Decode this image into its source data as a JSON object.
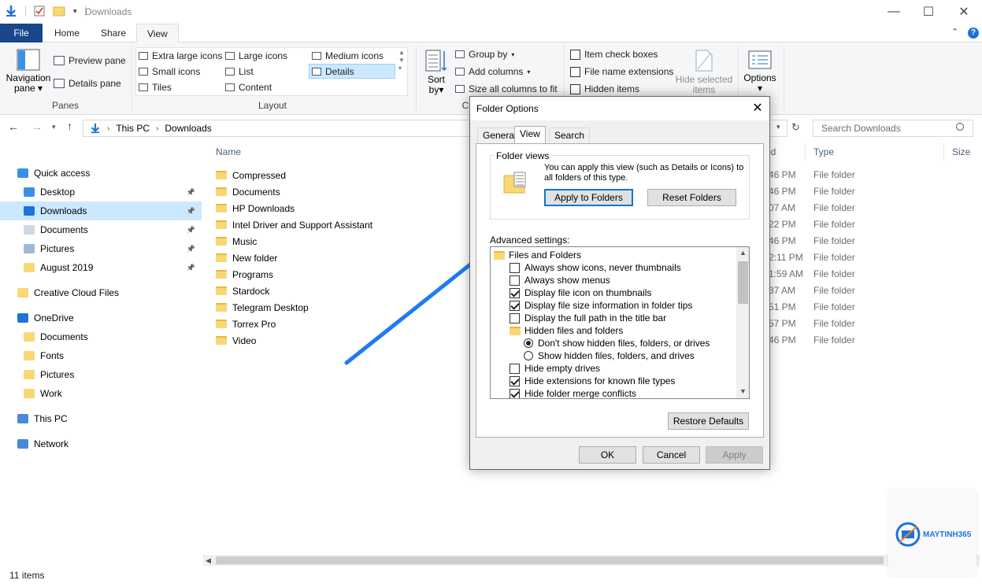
{
  "window": {
    "title": "Downloads"
  },
  "ribbon_tabs": [
    {
      "label": "File"
    },
    {
      "label": "Home"
    },
    {
      "label": "Share"
    },
    {
      "label": "View"
    }
  ],
  "ribbon": {
    "panes": {
      "navigation_pane": "Navigation",
      "navigation_pane2": "pane",
      "preview_pane": "Preview pane",
      "details_pane": "Details pane",
      "group_label": "Panes"
    },
    "layout": {
      "items": [
        "Extra large icons",
        "Large icons",
        "Medium icons",
        "Small icons",
        "List",
        "Details",
        "Tiles",
        "Content"
      ],
      "group_label": "Layout"
    },
    "current_view": {
      "sort_by": "Sort",
      "sort_by2": "by",
      "group_by": "Group by",
      "add_columns": "Add columns",
      "size_columns": "Size all columns to fit",
      "group_label": "C"
    },
    "show_hide": {
      "item_check_boxes": "Item check boxes",
      "file_name_extensions": "File name extensions",
      "hidden_items": "Hidden items",
      "hide_selected": "Hide selected",
      "hide_selected2": "items"
    },
    "options": "Options"
  },
  "address": {
    "crumbs": [
      "This PC",
      "Downloads"
    ],
    "search_placeholder": "Search Downloads"
  },
  "nav": {
    "items": [
      {
        "label": "Quick access"
      },
      {
        "label": "Desktop"
      },
      {
        "label": "Downloads"
      },
      {
        "label": "Documents"
      },
      {
        "label": "Pictures"
      },
      {
        "label": "August 2019"
      },
      {
        "label": "Creative Cloud Files"
      },
      {
        "label": "OneDrive"
      },
      {
        "label": "Documents"
      },
      {
        "label": "Fonts"
      },
      {
        "label": "Pictures"
      },
      {
        "label": "Work"
      },
      {
        "label": "This PC"
      },
      {
        "label": "Network"
      }
    ]
  },
  "list": {
    "headers": {
      "name": "Name",
      "date": "ed",
      "type": "Type",
      "size": "Size"
    },
    "rows": [
      {
        "name": "Compressed",
        "time": "46 PM",
        "type": "File folder"
      },
      {
        "name": "Documents",
        "time": "46 PM",
        "type": "File folder"
      },
      {
        "name": "HP Downloads",
        "time": "07 AM",
        "type": "File folder"
      },
      {
        "name": "Intel Driver and Support Assistant",
        "time": "22 PM",
        "type": "File folder"
      },
      {
        "name": "Music",
        "time": "46 PM",
        "type": "File folder"
      },
      {
        "name": "New folder",
        "time": "2:11 PM",
        "type": "File folder"
      },
      {
        "name": "Programs",
        "time": "1:59 AM",
        "type": "File folder"
      },
      {
        "name": "Stardock",
        "time": "37 AM",
        "type": "File folder"
      },
      {
        "name": "Telegram Desktop",
        "time": "51 PM",
        "type": "File folder"
      },
      {
        "name": "Torrex Pro",
        "time": "57 PM",
        "type": "File folder"
      },
      {
        "name": "Video",
        "time": "46 PM",
        "type": "File folder"
      }
    ]
  },
  "status": {
    "count": "11 items"
  },
  "dialog": {
    "title": "Folder Options",
    "tabs": [
      "General",
      "View",
      "Search"
    ],
    "folder_views_label": "Folder views",
    "folder_views_desc1": "You can apply this view (such as Details or Icons) to",
    "folder_views_desc2": "all folders of this type.",
    "apply_to_folders": "Apply to Folders",
    "reset_folders": "Reset Folders",
    "advanced_label": "Advanced settings:",
    "tree": [
      {
        "label": "Files and Folders",
        "kind": "folder"
      },
      {
        "label": "Always show icons, never thumbnails",
        "kind": "check",
        "checked": false
      },
      {
        "label": "Always show menus",
        "kind": "check",
        "checked": false
      },
      {
        "label": "Display file icon on thumbnails",
        "kind": "check",
        "checked": true
      },
      {
        "label": "Display file size information in folder tips",
        "kind": "check",
        "checked": true
      },
      {
        "label": "Display the full path in the title bar",
        "kind": "check",
        "checked": false
      },
      {
        "label": "Hidden files and folders",
        "kind": "folder"
      },
      {
        "label": "Don't show hidden files, folders, or drives",
        "kind": "radio",
        "checked": true
      },
      {
        "label": "Show hidden files, folders, and drives",
        "kind": "radio",
        "checked": false
      },
      {
        "label": "Hide empty drives",
        "kind": "check",
        "checked": false
      },
      {
        "label": "Hide extensions for known file types",
        "kind": "check",
        "checked": true
      },
      {
        "label": "Hide folder merge conflicts",
        "kind": "check",
        "checked": true
      }
    ],
    "restore_defaults": "Restore Defaults",
    "ok": "OK",
    "cancel": "Cancel",
    "apply": "Apply"
  },
  "watermark": {
    "brand": "MAYTINH365"
  },
  "colors": {
    "accent": "#0078d7",
    "file_tab": "#19478a",
    "selection": "#cce8ff",
    "arrow": "#1e7cf2"
  }
}
